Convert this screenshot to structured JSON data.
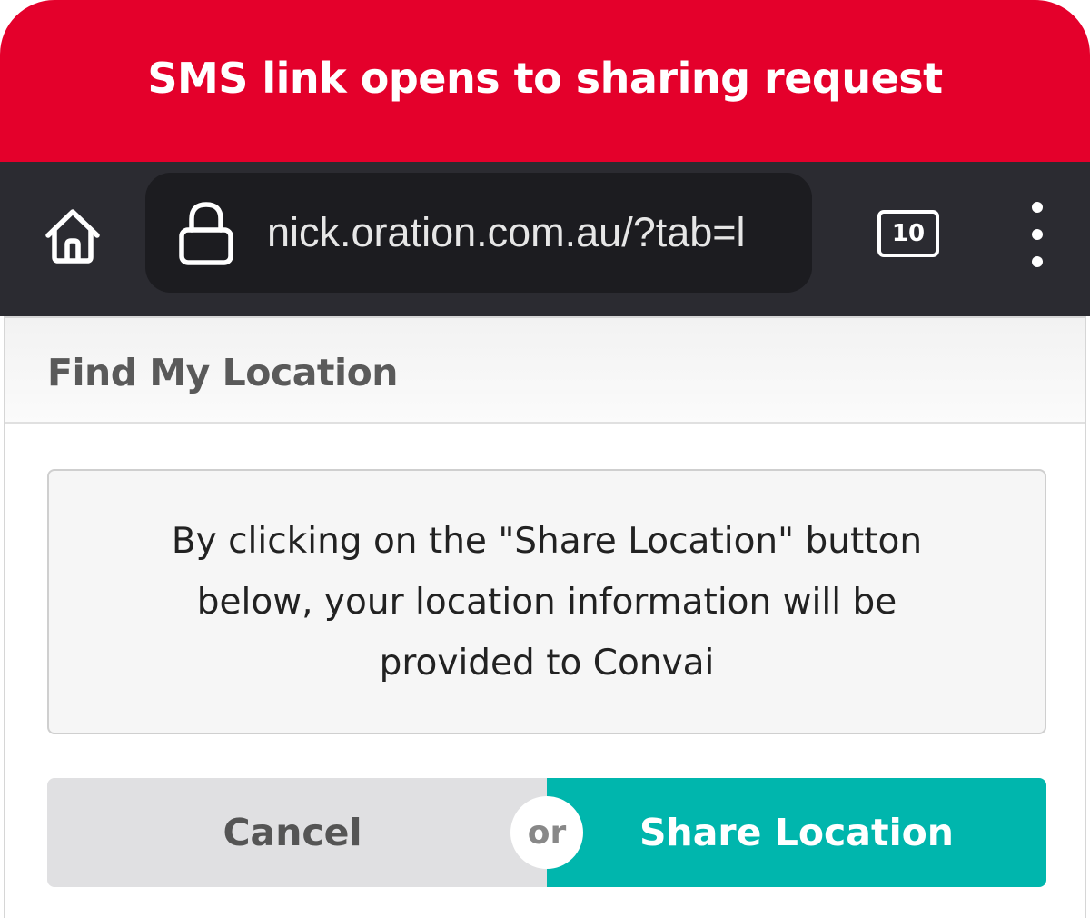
{
  "banner": {
    "title": "SMS link opens to sharing request"
  },
  "browser": {
    "url": "nick.oration.com.au/?tab=l",
    "tab_count": "10",
    "icons": {
      "home": "home-icon",
      "lock": "lock-icon",
      "tabs": "tabs-icon",
      "menu": "more-vert-icon"
    }
  },
  "panel": {
    "title": "Find My Location",
    "notice": "By clicking on the \"Share Location\" button below, your location information will be provided to Convai",
    "cancel_label": "Cancel",
    "or_label": "or",
    "share_label": "Share Location"
  },
  "colors": {
    "banner": "#e4002b",
    "toolbar": "#2b2b31",
    "share_button": "#00b6ad",
    "cancel_button": "#e0e0e2"
  }
}
